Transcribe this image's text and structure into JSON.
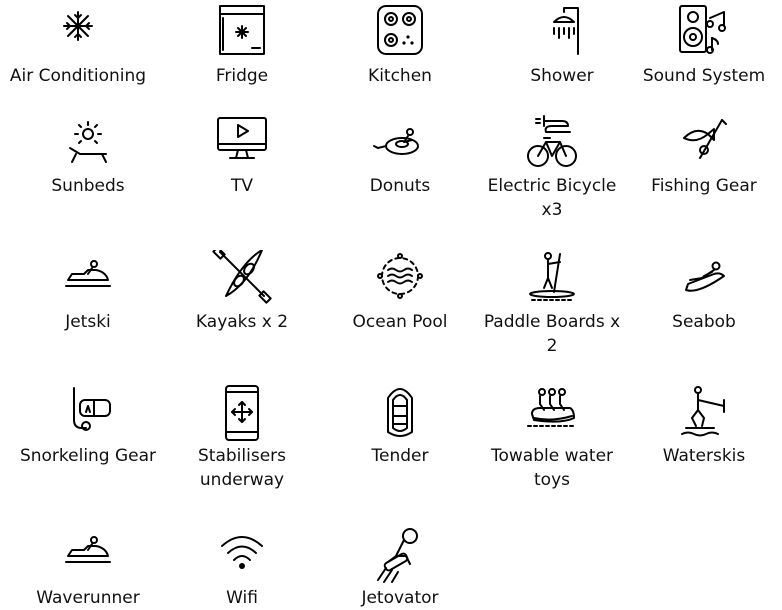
{
  "amenities": [
    {
      "label": "Air Conditioning",
      "icon": "snowflake-icon"
    },
    {
      "label": "Fridge",
      "icon": "fridge-icon"
    },
    {
      "label": "Kitchen",
      "icon": "stove-icon"
    },
    {
      "label": "Shower",
      "icon": "shower-icon"
    },
    {
      "label": "Sound System",
      "icon": "speaker-music-icon"
    },
    {
      "label": "Sunbeds",
      "icon": "sunbed-icon"
    },
    {
      "label": "TV",
      "icon": "tv-icon"
    },
    {
      "label": "Donuts",
      "icon": "donut-tube-icon"
    },
    {
      "label": "Electric Bicycle x3",
      "icon": "electric-bicycle-icon"
    },
    {
      "label": "Fishing Gear",
      "icon": "fishing-gear-icon"
    },
    {
      "label": "Jetski",
      "icon": "jetski-icon"
    },
    {
      "label": "Kayaks x 2",
      "icon": "kayak-icon"
    },
    {
      "label": "Ocean Pool",
      "icon": "ocean-pool-icon"
    },
    {
      "label": "Paddle Boards x 2",
      "icon": "paddle-board-icon"
    },
    {
      "label": "Seabob",
      "icon": "seabob-icon"
    },
    {
      "label": "Snorkeling Gear",
      "icon": "snorkel-icon"
    },
    {
      "label": "Stabilisers underway",
      "icon": "stabilisers-icon"
    },
    {
      "label": "Tender",
      "icon": "tender-boat-icon"
    },
    {
      "label": "Towable water toys",
      "icon": "towable-toys-icon"
    },
    {
      "label": "Waterskis",
      "icon": "waterski-icon"
    },
    {
      "label": "Waverunner",
      "icon": "waverunner-icon"
    },
    {
      "label": "Wifi",
      "icon": "wifi-icon"
    },
    {
      "label": "Jetovator",
      "icon": "jetovator-icon"
    }
  ]
}
